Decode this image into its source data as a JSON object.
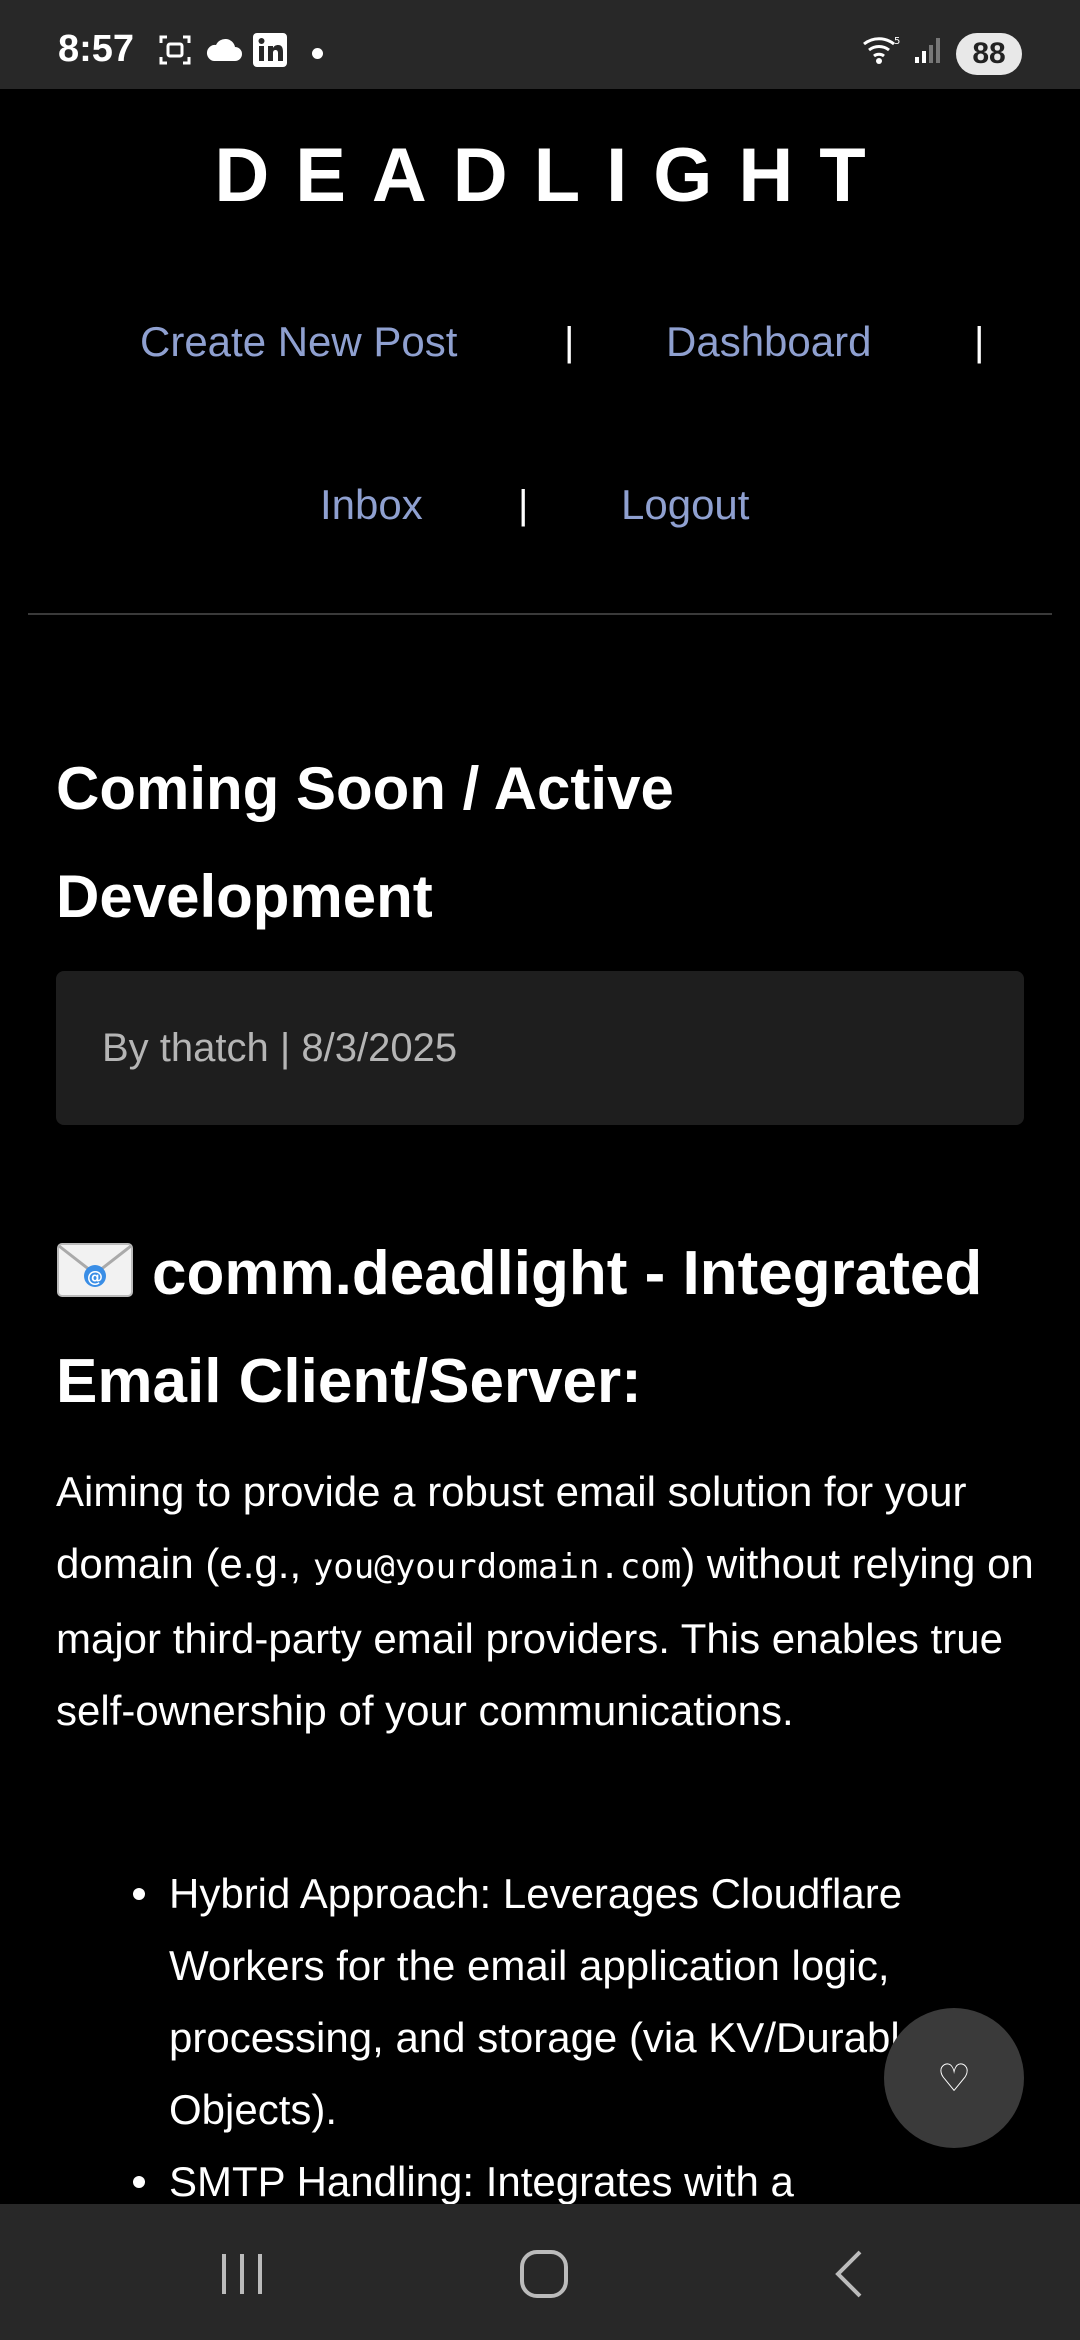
{
  "status_bar": {
    "time": "8:57",
    "battery": "88",
    "icons": [
      "screenshot-icon",
      "cloud-icon",
      "linkedin-icon",
      "notification-dot",
      "wifi-icon",
      "signal-icon"
    ]
  },
  "header": {
    "brand": "DEADLIGHT",
    "nav": {
      "create_post": "Create New Post",
      "dashboard": "Dashboard",
      "inbox": "Inbox",
      "logout": "Logout",
      "separator": "|"
    }
  },
  "post": {
    "title": "Coming Soon / Active Development",
    "meta": "By thatch | 8/3/2025",
    "section_heading": "comm.deadlight - Integrated Email Client/Server:",
    "paragraph_before": "Aiming to provide a robust email solution for your domain (e.g., ",
    "paragraph_code": "you@yourdomain.com",
    "paragraph_after": ") without relying on major third-party email providers. This enables true self-ownership of your communications.",
    "bullets": [
      "Hybrid Approach: Leverages Cloudflare Workers for the email application logic, processing, and storage (via KV/Durable Objects).",
      "SMTP Handling: Integrates with a"
    ]
  },
  "fab": {
    "icon": "♡"
  },
  "colors": {
    "background": "#000000",
    "link": "#8fa0d0",
    "meta_box": "#1e1e1e",
    "bars": "#282828"
  }
}
